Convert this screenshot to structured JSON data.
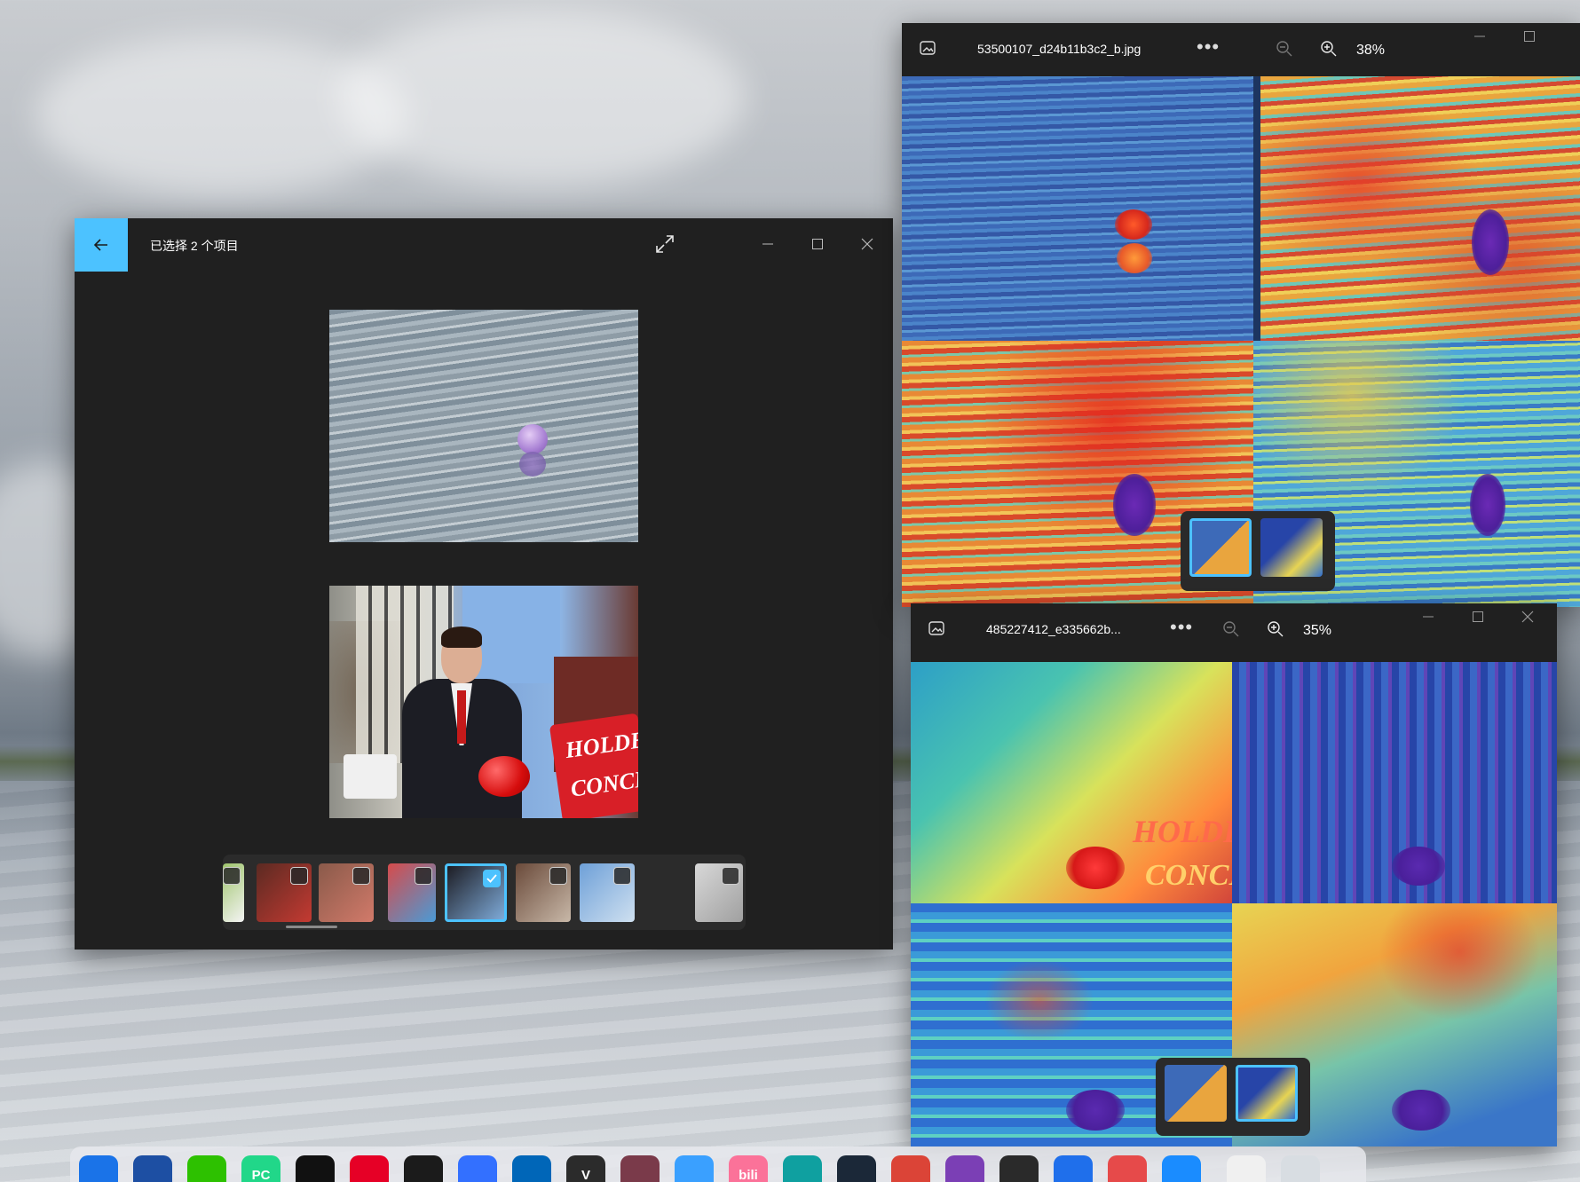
{
  "selection_window": {
    "title": "已选择 2 个项目",
    "banner_lines": [
      "HOLDEN",
      "CONCER"
    ],
    "thumbnails": [
      {
        "name": "thumb-1",
        "colors": [
          "#9ec46b",
          "#f4f4f4"
        ],
        "selected": false
      },
      {
        "name": "thumb-2",
        "colors": [
          "#5b2a22",
          "#c43a32"
        ],
        "selected": false
      },
      {
        "name": "thumb-3",
        "colors": [
          "#8a5a4a",
          "#d27a6a"
        ],
        "selected": false
      },
      {
        "name": "thumb-4",
        "colors": [
          "#d64b4b",
          "#4a9bd6"
        ],
        "selected": false
      },
      {
        "name": "thumb-5",
        "colors": [
          "#1d1d24",
          "#7eaad8"
        ],
        "selected": true
      },
      {
        "name": "thumb-6",
        "colors": [
          "#6a4a3a",
          "#c8b8a8"
        ],
        "selected": false
      },
      {
        "name": "thumb-7",
        "colors": [
          "#6ea0d8",
          "#cfe0f0"
        ],
        "selected": false
      },
      {
        "name": "thumb-8",
        "colors": [
          "#d8d8d8",
          "#a0a0a0"
        ],
        "selected": false
      }
    ]
  },
  "viewer1": {
    "filename": "53500107_d24b11b3c2_b.jpg",
    "more": "•••",
    "zoom": "38%"
  },
  "viewer2": {
    "filename": "485227412_e335662b...",
    "more": "•••",
    "zoom": "35%",
    "banner_lines": [
      "HOLDEN",
      "CONCER"
    ]
  },
  "taskbar": {
    "apps": [
      {
        "name": "start",
        "color": "#1a73e8",
        "label": ""
      },
      {
        "name": "rocket",
        "color": "#1d4fa3",
        "label": ""
      },
      {
        "name": "wechat",
        "color": "#2dc100",
        "label": ""
      },
      {
        "name": "pycharm",
        "color": "#21d789",
        "label": "PC"
      },
      {
        "name": "qq",
        "color": "#111111",
        "label": ""
      },
      {
        "name": "netease-music",
        "color": "#e60026",
        "label": ""
      },
      {
        "name": "app-dark",
        "color": "#1b1b1b",
        "label": ""
      },
      {
        "name": "feishu",
        "color": "#3370ff",
        "label": ""
      },
      {
        "name": "vscode",
        "color": "#0066b8",
        "label": ""
      },
      {
        "name": "vim",
        "color": "#2b2b2b",
        "label": "V"
      },
      {
        "name": "anime-app",
        "color": "#7a3a4a",
        "label": ""
      },
      {
        "name": "cat-app",
        "color": "#3aa0ff",
        "label": ""
      },
      {
        "name": "bilibili",
        "color": "#fb7299",
        "label": "bili"
      },
      {
        "name": "edge",
        "color": "#0fa0a0",
        "label": ""
      },
      {
        "name": "steam",
        "color": "#1b2838",
        "label": ""
      },
      {
        "name": "chrome",
        "color": "#db4437",
        "label": ""
      },
      {
        "name": "visual-studio",
        "color": "#7b3fb5",
        "label": ""
      },
      {
        "name": "terminal",
        "color": "#2a2a2a",
        "label": ""
      },
      {
        "name": "notepad",
        "color": "#1f6feb",
        "label": ""
      },
      {
        "name": "snipping",
        "color": "#e64a4a",
        "label": ""
      },
      {
        "name": "photos",
        "color": "#1a8cff",
        "label": ""
      },
      {
        "name": "blank-doc",
        "color": "#f0f0f0",
        "label": ""
      },
      {
        "name": "recycle-bin",
        "color": "#d8dde2",
        "label": ""
      }
    ]
  }
}
